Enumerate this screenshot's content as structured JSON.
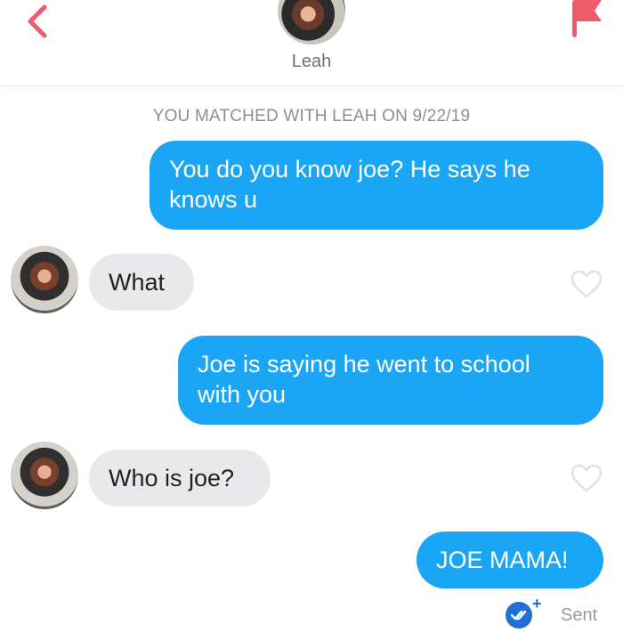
{
  "header": {
    "contact_name": "Leah",
    "back_icon": "chevron-left-icon",
    "report_icon": "flag-icon",
    "accent_color": "#ef5b6b"
  },
  "match_banner": "YOU MATCHED WITH LEAH ON 9/22/19",
  "messages": [
    {
      "direction": "sent",
      "text_lines": [
        "You do you know joe? He says he",
        "knows u"
      ]
    },
    {
      "direction": "received",
      "text_lines": [
        "What"
      ],
      "like_icon": "heart-outline-icon"
    },
    {
      "direction": "sent",
      "text_lines": [
        "Joe is saying he went to school",
        "with you"
      ]
    },
    {
      "direction": "received",
      "text_lines": [
        "Who is joe?"
      ],
      "like_icon": "heart-outline-icon"
    },
    {
      "direction": "sent",
      "text_lines": [
        "JOE MAMA!"
      ]
    }
  ],
  "status": {
    "icon": "double-check-icon",
    "plus": "+",
    "label": "Sent"
  },
  "colors": {
    "sent_bubble": "#1aa6f5",
    "received_bubble": "#e9e9eb",
    "status_badge": "#1f6fd6"
  }
}
